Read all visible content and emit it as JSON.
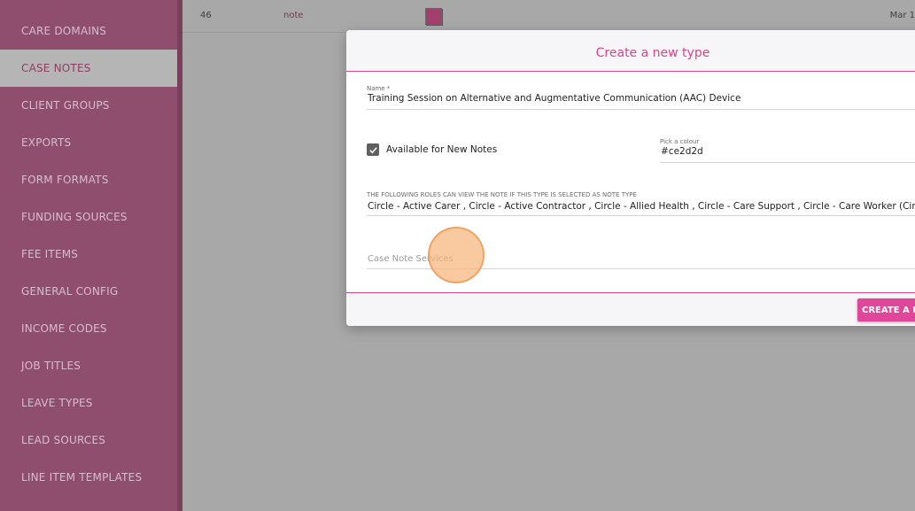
{
  "sidebar": {
    "items": [
      {
        "label": "CARE DOMAINS",
        "active": false
      },
      {
        "label": "CASE NOTES",
        "active": true
      },
      {
        "label": "CLIENT GROUPS",
        "active": false
      },
      {
        "label": "EXPORTS",
        "active": false
      },
      {
        "label": "FORM FORMATS",
        "active": false
      },
      {
        "label": "FUNDING SOURCES",
        "active": false
      },
      {
        "label": "FEE ITEMS",
        "active": false
      },
      {
        "label": "GENERAL CONFIG",
        "active": false
      },
      {
        "label": "INCOME CODES",
        "active": false
      },
      {
        "label": "JOB TITLES",
        "active": false
      },
      {
        "label": "LEAVE TYPES",
        "active": false
      },
      {
        "label": "LEAD SOURCES",
        "active": false
      },
      {
        "label": "LINE ITEM TEMPLATES",
        "active": false
      }
    ]
  },
  "table_row": {
    "id": "46",
    "name": "note",
    "date": "Mar 1"
  },
  "modal": {
    "title": "Create a new type",
    "name_label": "Name *",
    "name_value": "Training Session on Alternative and Augmentative Communication (AAC) Device",
    "available_label": "Available for New Notes",
    "available_checked": true,
    "colour_label": "Pick a colour",
    "colour_value": "#ce2d2d",
    "roles_label": "THE FOLLOWING ROLES CAN VIEW THE NOTE IF THIS TYPE IS SELECTED AS NOTE TYPE",
    "roles_value": "Circle - Active Carer , Circle - Active Contractor , Circle - Allied Health , Circle - Care Support , Circle - Care Worker (Circle) , Circle -",
    "services_placeholder": "Case Note Services",
    "create_button": "CREATE A NE"
  },
  "colors": {
    "accent": "#e0479a",
    "sidebar": "#8f4e6d",
    "swatch": "#a23f6d"
  }
}
